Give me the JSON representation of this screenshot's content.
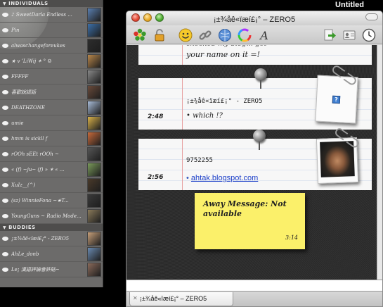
{
  "desktop": {
    "window_title": "Untitled"
  },
  "buddy_list": {
    "groups": [
      {
        "label": "INDIVIDUALS",
        "buddies": [
          {
            "name": "♪ SweetDarla Endless ..."
          },
          {
            "name": "Pin"
          },
          {
            "name": "alwaschangeforeukes"
          },
          {
            "name": "★ v ’LiWij ✶ ° ☺"
          },
          {
            "name": "FFFFF"
          },
          {
            "name": "喜歡說謊話"
          },
          {
            "name": "DEATHZONE"
          },
          {
            "name": "umie"
          },
          {
            "name": "hmm is sickll f"
          },
          {
            "name": "rOOh sEEt rOOh ~"
          },
          {
            "name": "« (f) ~ju~ (f) » ✶ « ..."
          },
          {
            "name": "XuIz__(^)"
          },
          {
            "name": "(sz) WinnieFona ~★T..."
          },
          {
            "name": "YoungGuns ~ Radio Mode..."
          }
        ]
      },
      {
        "label": "BUDDIES",
        "buddies": [
          {
            "name": "¡±¾åê«ïæí£¡° - ZERO5"
          },
          {
            "name": "AhLe_donb"
          },
          {
            "name": "Le¡ 漢語評論會許貼~"
          }
        ]
      }
    ]
  },
  "chat_window": {
    "title": "¡±¾åê«ïæí£¡° – ZERO5",
    "tab_label": "¡±¾åê«ïæí£¡° – ZERO5"
  },
  "toolbar": {
    "icons": [
      "icq-flower-icon",
      "lock-icon",
      "smiley-icon",
      "chain-link-icon",
      "globe-icon",
      "color-wheel-icon",
      "font-a-icon",
      "send-file-icon",
      "contact-card-icon",
      "clock-icon"
    ]
  },
  "transcript": {
    "message1": {
      "text": "your name on it =!"
    },
    "message2": {
      "sender": "¡±¾åê«ïæí£¡° - ZERO5",
      "time": "2:48",
      "text": "• which !?"
    },
    "message3": {
      "sender": "9752255",
      "time": "2:56",
      "link": "ahtak.blogspot.com"
    },
    "away": {
      "text": "Away Message: Not available",
      "time": "3:14"
    }
  },
  "colors": {
    "sticky": "#fbf06a",
    "link": "#1c3fc9",
    "margin_line": "#e7a0a0"
  }
}
